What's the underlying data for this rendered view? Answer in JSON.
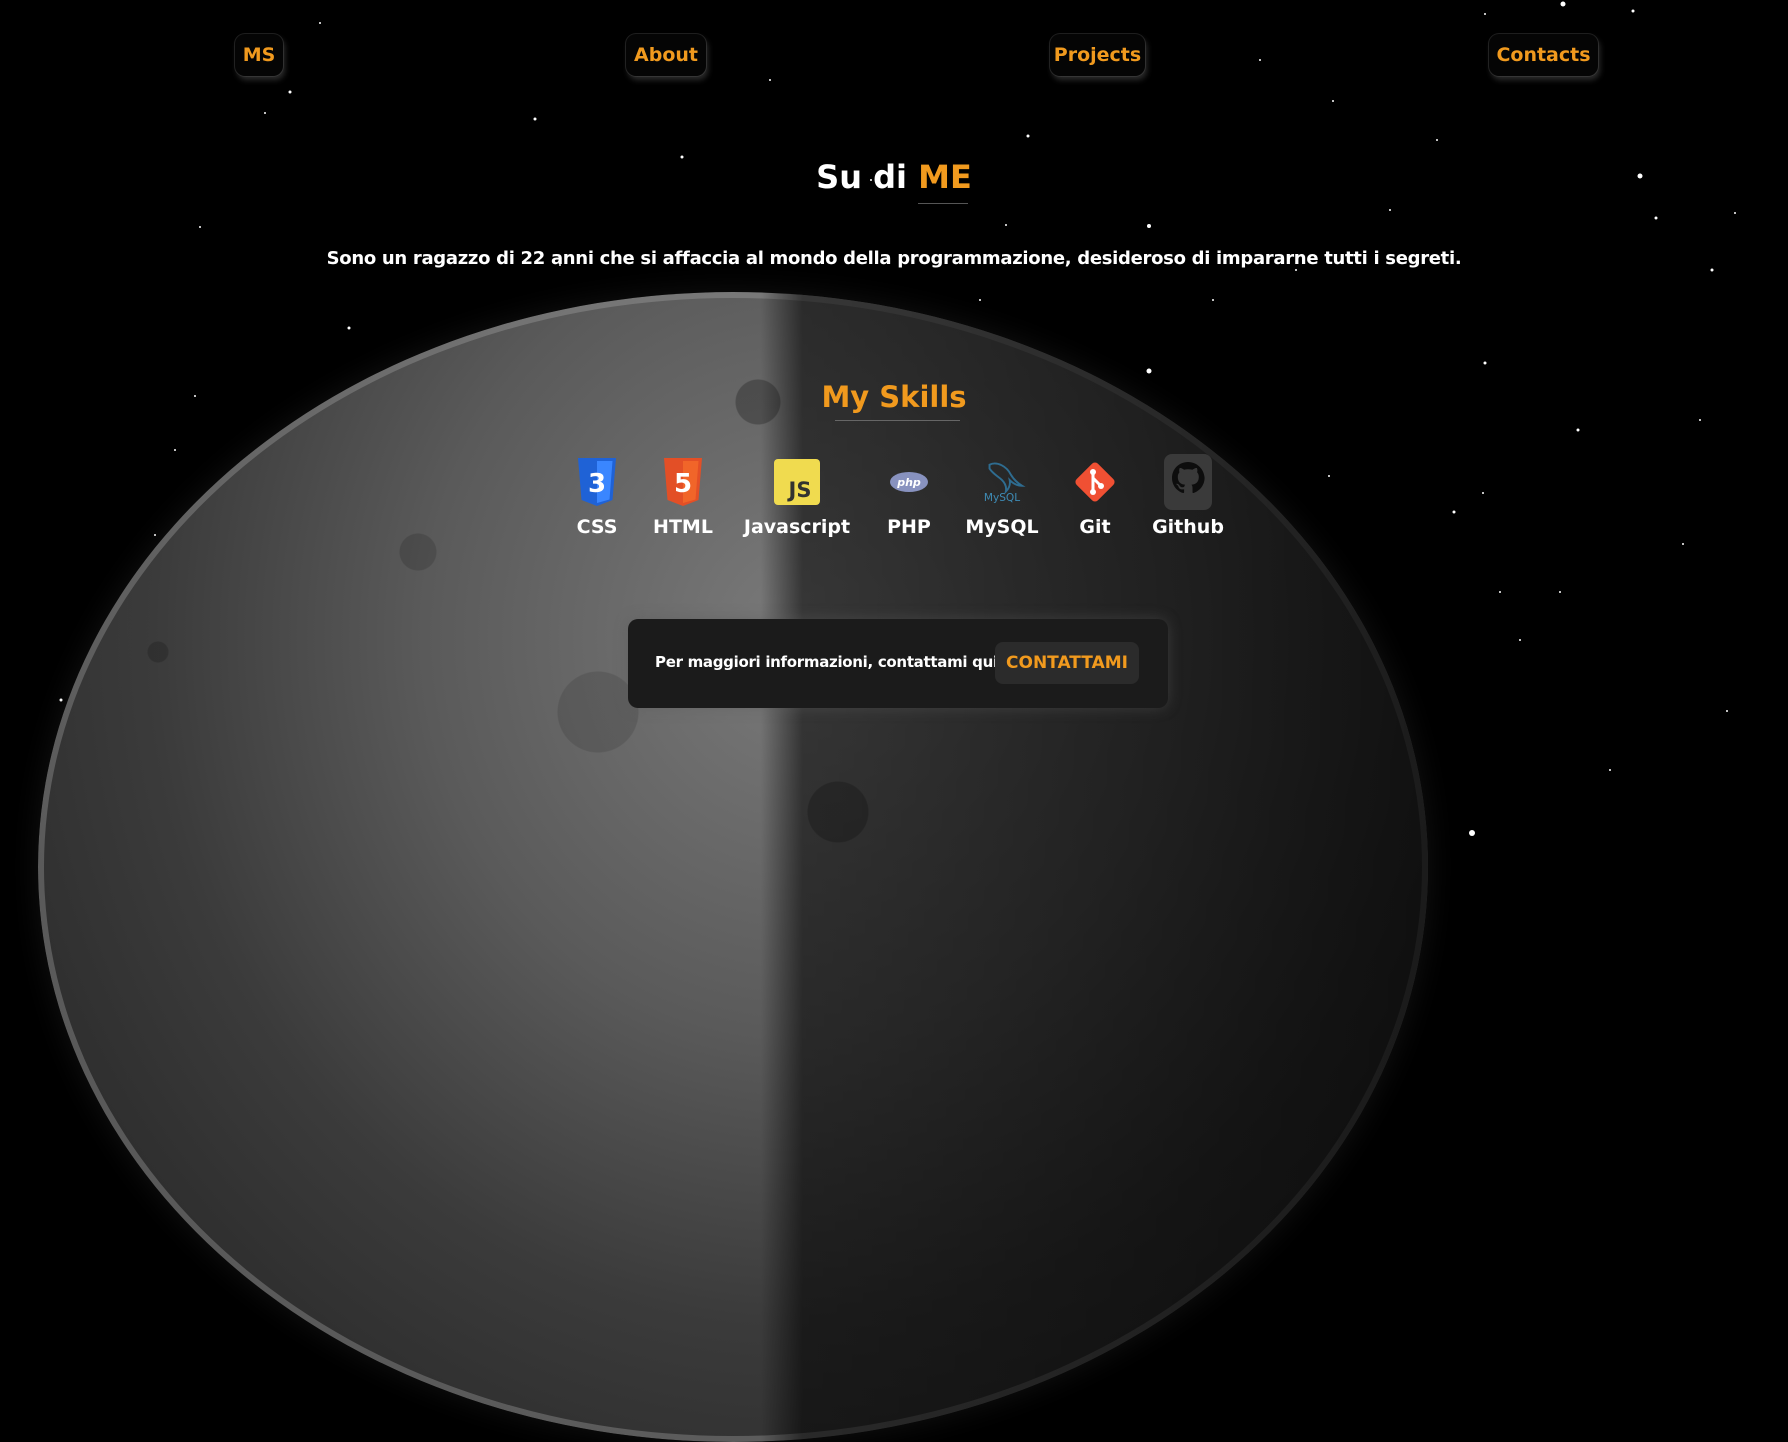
{
  "nav": {
    "logo": "MS",
    "items": [
      "About",
      "Projects",
      "Contacts"
    ]
  },
  "about": {
    "title_prefix": "Su di",
    "title_accent": "ME",
    "intro": "Sono un ragazzo di 22 anni che si affaccia al mondo della programmazione, desideroso di impararne tutti i segreti."
  },
  "skills": {
    "title": "My Skills",
    "items": [
      {
        "label": "CSS",
        "icon": "css3-icon"
      },
      {
        "label": "HTML",
        "icon": "html5-icon"
      },
      {
        "label": "Javascript",
        "icon": "javascript-icon"
      },
      {
        "label": "PHP",
        "icon": "php-icon"
      },
      {
        "label": "MySQL",
        "icon": "mysql-icon"
      },
      {
        "label": "Git",
        "icon": "git-icon"
      },
      {
        "label": "Github",
        "icon": "github-icon"
      }
    ],
    "icon_glyphs": {
      "css": "3",
      "html": "5",
      "js": "JS",
      "php": "php",
      "mysql": "MySQL"
    }
  },
  "contact": {
    "text": "Per maggiori informazioni, contattami qui:",
    "button": "CONTATTAMI"
  },
  "colors": {
    "accent": "#f19a1e",
    "background": "#000000",
    "card": "#1b1b1b"
  }
}
